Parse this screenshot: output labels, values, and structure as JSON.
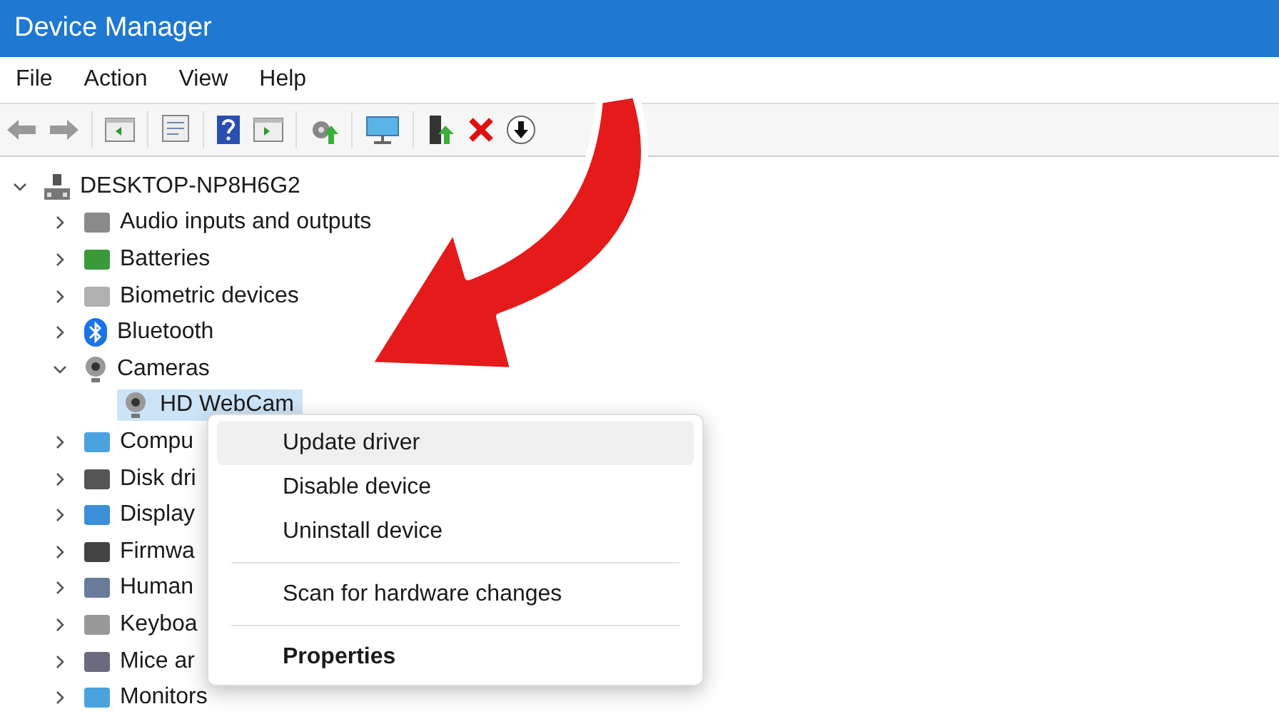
{
  "window": {
    "title": "Device Manager"
  },
  "menu_bar": [
    "File",
    "Action",
    "View",
    "Help"
  ],
  "tree": {
    "label": "DESKTOP-NP8H6G2",
    "expanded": true,
    "children": [
      {
        "label": "Audio inputs and outputs",
        "expanded": false
      },
      {
        "label": "Batteries",
        "expanded": false
      },
      {
        "label": "Biometric devices",
        "expanded": false
      },
      {
        "label": "Bluetooth",
        "expanded": false
      },
      {
        "label": "Cameras",
        "expanded": true,
        "children": [
          {
            "label": "HD WebCam",
            "selected": true
          }
        ]
      },
      {
        "label": "Compu",
        "expanded": false
      },
      {
        "label": "Disk dri",
        "expanded": false
      },
      {
        "label": "Display",
        "expanded": false
      },
      {
        "label": "Firmwa",
        "expanded": false
      },
      {
        "label": "Human",
        "expanded": false
      },
      {
        "label": "Keyboa",
        "expanded": false
      },
      {
        "label": "Mice ar",
        "expanded": false
      },
      {
        "label": "Monitors",
        "expanded": false
      }
    ]
  },
  "context_menu": [
    {
      "kind": "item",
      "label": "Update driver",
      "highlighted": true
    },
    {
      "kind": "item",
      "label": "Disable device",
      "highlighted": false
    },
    {
      "kind": "item",
      "label": "Uninstall device",
      "highlighted": false
    },
    {
      "kind": "separator"
    },
    {
      "kind": "item",
      "label": "Scan for hardware changes",
      "highlighted": false
    },
    {
      "kind": "separator"
    },
    {
      "kind": "default",
      "label": "Properties",
      "highlighted": false
    }
  ]
}
